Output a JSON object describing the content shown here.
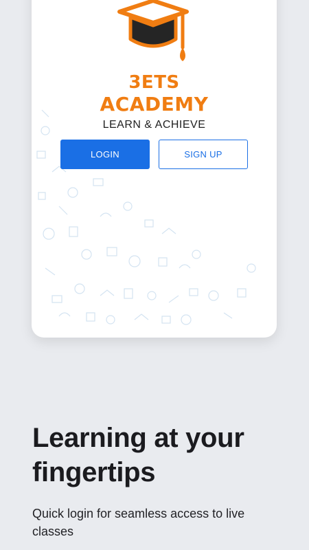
{
  "brand": {
    "name_line1": "3ETS",
    "name_line2": "ACADEMY",
    "tagline": "LEARN & ACHIEVE",
    "accent_color": "#f07d12"
  },
  "auth": {
    "login_label": "LOGIN",
    "signup_label": "SIGN UP",
    "primary_color": "#1a6fe5"
  },
  "promo": {
    "headline": "Learning at your fingertips",
    "subtext": "Quick login for seamless access to live classes"
  },
  "icons": [
    "graduation-cap-logo",
    "doodle-pattern"
  ]
}
